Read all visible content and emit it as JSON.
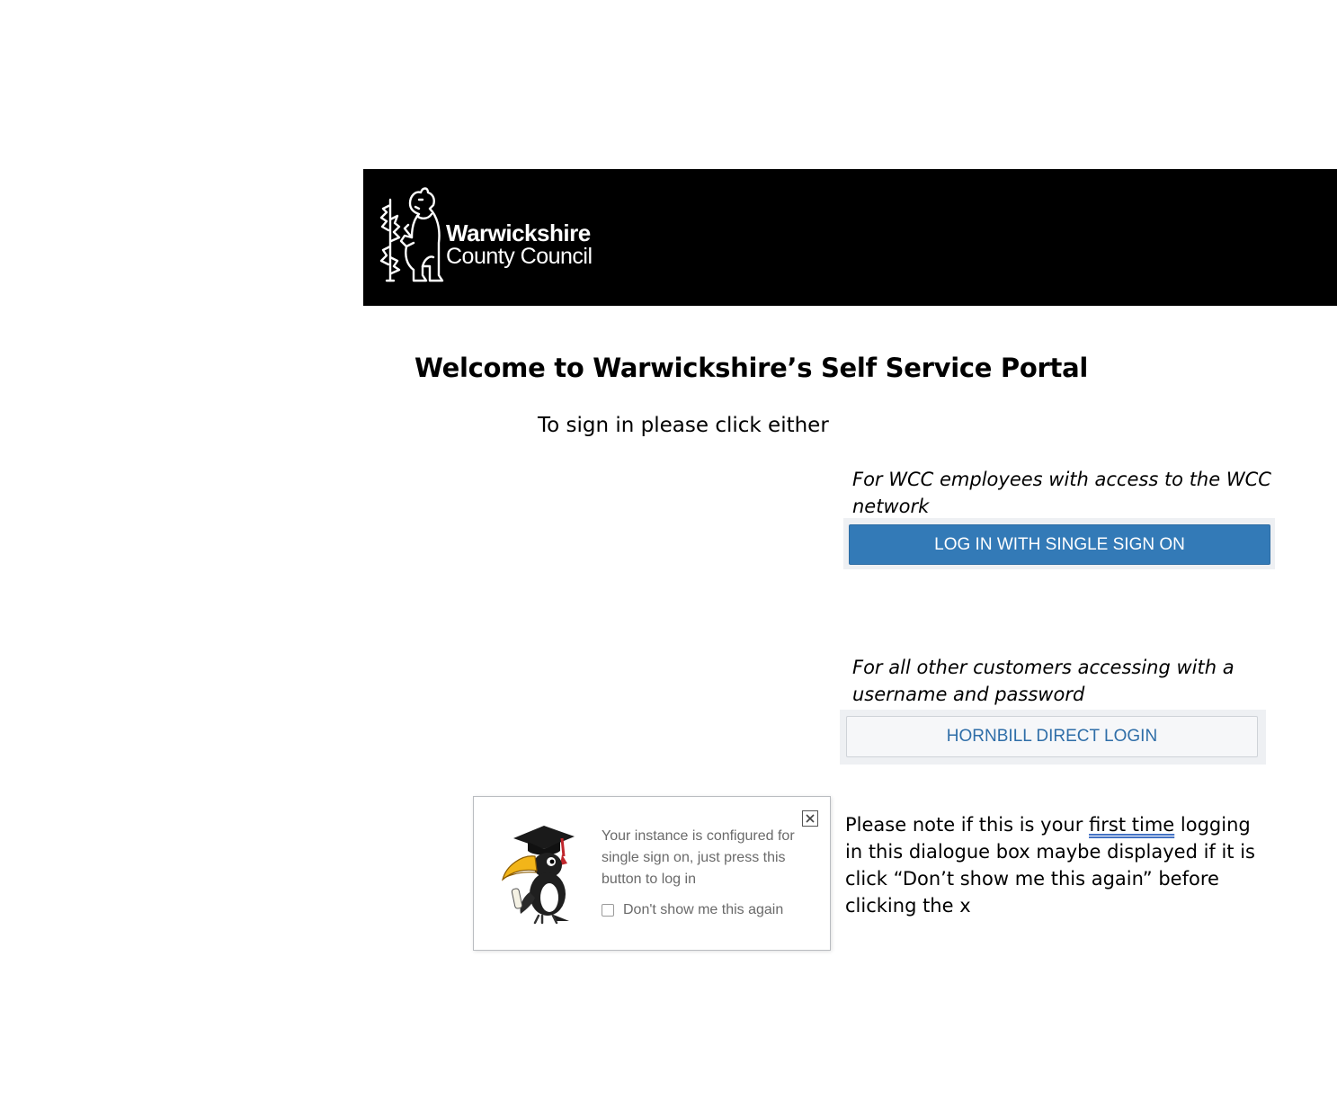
{
  "header": {
    "logo_line1": "Warwickshire",
    "logo_line2": "County Council",
    "background_color": "#000000",
    "logo_icon": "bear-and-ragged-staff-crest-icon"
  },
  "main": {
    "title": "Welcome to Warwickshire’s Self Service Portal",
    "subtitle": "To sign in please click either"
  },
  "sso_option": {
    "caption": "For WCC employees with access to the WCC network",
    "button_label": "LOG IN WITH SINGLE SIGN ON",
    "button_color": "#337ab7"
  },
  "direct_option": {
    "caption": "For all other customers accessing with a username and password",
    "button_label": "HORNBILL DIRECT LOGIN",
    "button_text_color": "#2f6ea8"
  },
  "dialog": {
    "message": "Your instance is configured for single sign on, just press this button to log in",
    "checkbox_label": "Don't show me this again",
    "checkbox_checked": false,
    "mascot_icon": "hornbill-graduate-mascot-icon",
    "close_icon": "close-x-icon"
  },
  "note": {
    "part1": "Please note if this is your ",
    "emphasis": "first time",
    "part2": " logging in this dialogue box maybe displayed if it is click “Don’t show me this again” before clicking the x"
  }
}
